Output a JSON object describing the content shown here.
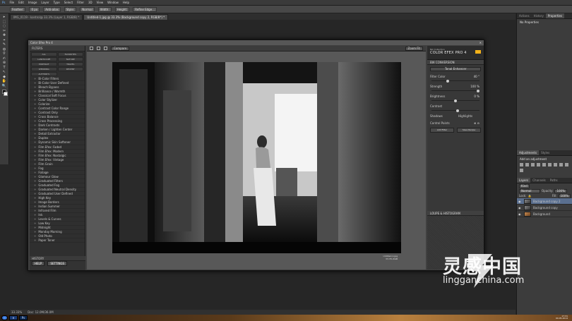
{
  "menubar": {
    "items": [
      "File",
      "Edit",
      "Image",
      "Layer",
      "Type",
      "Select",
      "Filter",
      "3D",
      "View",
      "Window",
      "Help"
    ]
  },
  "optionsbar": {
    "feather_label": "Feather:",
    "feather_value": "0 px",
    "antialias": "Anti-alias",
    "style_label": "Style:",
    "style_value": "Normal",
    "width_label": "Width:",
    "height_label": "Height:",
    "refine": "Refine Edge..."
  },
  "doc_tabs": [
    {
      "label": "IMG_0119 - kontrol@ 33.3% (Layer 1, RGB/8) *"
    },
    {
      "label": "Untitled-1.jpg @ 33.3% (Background copy 2, RGB/8*) *"
    }
  ],
  "toolbox": {
    "tools": [
      "▸",
      "⬚",
      "◌",
      "✂",
      "✚",
      "⌖",
      "✎",
      "◍",
      "⚲",
      "✍",
      "⊛",
      "T",
      "↖",
      "◆",
      "✋",
      "🔍"
    ]
  },
  "cef": {
    "window_title": "Color Efex Pro 4",
    "filter_header": "FILTERS",
    "categories": [
      "ALL",
      "FAVORITES",
      "LANDSCAPE",
      "NATURE",
      "PORTRAIT",
      "TRAVEL",
      "WEDDING",
      "RECENT",
      "AUTHOR'S"
    ],
    "filters": [
      "Bi-Color Filters",
      "Bi-Color User Defined",
      "Bleach Bypass",
      "Brilliance / Warmth",
      "Classical Soft Focus",
      "Color Stylizer",
      "Colorize",
      "Contrast Color Range",
      "Contrast Only",
      "Cross Balance",
      "Cross Processing",
      "Dark Contrasts",
      "Darken / Lighten Center",
      "Detail Extractor",
      "Duplex",
      "Dynamic Skin Softener",
      "Film Efex: Faded",
      "Film Efex: Modern",
      "Film Efex: Nostalgic",
      "Film Efex: Vintage",
      "Film Grain",
      "Fog",
      "Foliage",
      "Glamour Glow",
      "Graduated Filters",
      "Graduated Fog",
      "Graduated Neutral Density",
      "Graduated User Defined",
      "High Key",
      "Image Borders",
      "Indian Summer",
      "Infrared Film",
      "Ink",
      "Levels & Curves",
      "Low Key",
      "Midnight",
      "Monday Morning",
      "Old Photo",
      "Paper Toner"
    ],
    "history_label": "HISTORY",
    "help_btn": "HELP",
    "settings_btn": "SETTINGS",
    "compare_label": "Compare",
    "view_label": "View",
    "zoom_label": "Zoom Fit",
    "brand_small": "Nik Collection",
    "brand_big": "COLOR EFEX PRO 4",
    "section_label": "BW CONVERSION",
    "filter_color_label": "Filter Color",
    "filter_color_select": "Tonal Enhancer",
    "controls": [
      {
        "label": "Filter Color",
        "value": "40 °",
        "level": 0.33
      },
      {
        "label": "Strength",
        "value": "100 %",
        "level": 1.0
      },
      {
        "label": "Brightness",
        "value": "0 %",
        "level": 0.5
      },
      {
        "label": "Contrast",
        "value": "",
        "level": 0.55
      }
    ],
    "shadows_label": "Shadows",
    "highlights_label": "Highlights",
    "control_points_label": "Control Points",
    "add_filter": "Add Filter",
    "save_recipe": "Save Recipe",
    "loupe_label": "LOUPE & HISTOGRAM",
    "photo_caption1": "Untitled-1.jpg",
    "photo_caption2": "33.3% RGB"
  },
  "rightpanel": {
    "top_tabs": [
      "Actions",
      "History",
      "Properties"
    ],
    "properties_text": "No Properties",
    "adj_tabs": [
      "Adjustments",
      "Styles"
    ],
    "adj_hint": "Add an adjustment",
    "layer_tabs": [
      "Layers",
      "Channels",
      "Paths"
    ],
    "kind_label": "Kind",
    "blend_mode": "Normal",
    "opacity_label": "Opacity:",
    "opacity_value": "100%",
    "lock_label": "Lock:",
    "fill_label": "Fill:",
    "fill_value": "100%",
    "layers": [
      {
        "name": "Background copy 2",
        "selected": true
      },
      {
        "name": "Background copy",
        "selected": false
      },
      {
        "name": "Background",
        "selected": false
      }
    ]
  },
  "statusbar": {
    "zoom": "33.33%",
    "doc": "Doc: 12.0M/36.0M"
  },
  "taskbar": {
    "apps": [
      "e",
      "Ps"
    ],
    "time": "17:31",
    "date": "04.05.2014"
  },
  "watermark": {
    "cn": "灵感中国",
    "url": "lingganchina.com"
  },
  "colors": {
    "accent": "#f2b21a",
    "selected_layer": "#5a6f8f"
  }
}
